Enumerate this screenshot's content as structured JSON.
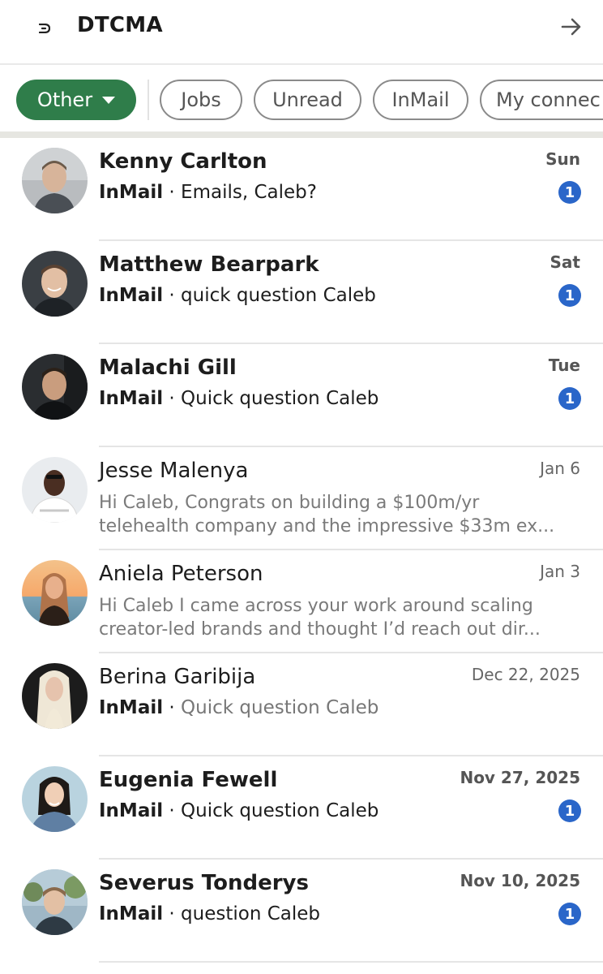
{
  "header": {
    "title": "DTCMA",
    "logo_icon": "dtcma-logo-icon",
    "exit_icon": "arrow-right-icon"
  },
  "filters": [
    {
      "label": "Other",
      "active": true
    },
    {
      "label": "Jobs",
      "active": false
    },
    {
      "label": "Unread",
      "active": false
    },
    {
      "label": "InMail",
      "active": false
    },
    {
      "label": "My connec",
      "active": false
    }
  ],
  "colors": {
    "accent_green": "#2f7d4a",
    "badge_blue": "#2a66c9"
  },
  "conversations": [
    {
      "name": "Kenny Carlton",
      "time": "Sun",
      "tag": "InMail",
      "sep": " · ",
      "message": "Emails, Caleb?",
      "unread": "1"
    },
    {
      "name": "Matthew Bearpark",
      "time": "Sat",
      "tag": "InMail",
      "sep": " · ",
      "message": "quick question Caleb",
      "unread": "1"
    },
    {
      "name": "Malachi Gill",
      "time": "Tue",
      "tag": "InMail",
      "sep": " · ",
      "message": "Quick question Caleb",
      "unread": "1"
    },
    {
      "name": "Jesse Malenya",
      "time": "Jan 6",
      "preview_line1": "Hi Caleb, Congrats on building a $100m/yr",
      "preview_line2": "telehealth company and the impressive $33m ex..."
    },
    {
      "name": "Aniela Peterson",
      "time": "Jan 3",
      "preview_line1": "Hi Caleb I came across your work around scaling",
      "preview_line2": "creator-led brands and thought I’d reach out dir..."
    },
    {
      "name": "Berina Garibija",
      "time": "Dec 22, 2025",
      "tag": "InMail",
      "sep": " · ",
      "message": "Quick question Caleb"
    },
    {
      "name": "Eugenia Fewell",
      "time": "Nov 27, 2025",
      "tag": "InMail",
      "sep": " · ",
      "message": "Quick question Caleb",
      "unread": "1"
    },
    {
      "name": "Severus Tonderys",
      "time": "Nov 10, 2025",
      "tag": "InMail",
      "sep": " · ",
      "message": "question Caleb",
      "unread": "1"
    }
  ]
}
